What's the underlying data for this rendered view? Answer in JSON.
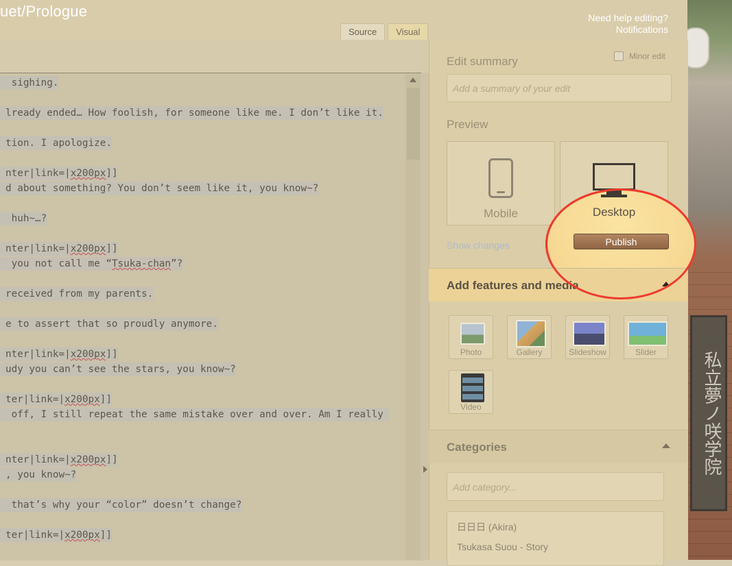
{
  "header": {
    "page_title": "uet/Prologue",
    "help_link": "Need help editing?",
    "notifications_link": "Notifications",
    "tabs": [
      {
        "label": "Source",
        "active": true
      },
      {
        "label": "Visual",
        "active": false
      }
    ]
  },
  "editor": {
    "lines": [
      {
        "parts": [
          {
            "t": " sighing."
          }
        ]
      },
      {
        "parts": [
          {
            "t": "lready ended… How foolish, for someone like me. I don’t like it."
          }
        ]
      },
      {
        "parts": [
          {
            "t": "tion. I apologize."
          }
        ]
      },
      {
        "parts": [
          {
            "t": "nter|link=|"
          },
          {
            "t": "x200px",
            "spell": true
          },
          {
            "t": "]]"
          }
        ]
      },
      {
        "parts": [
          {
            "t": "d about something? You don’t seem like it, you know~?"
          }
        ]
      },
      {
        "parts": [
          {
            "t": " huh~…?"
          }
        ]
      },
      {
        "parts": [
          {
            "t": "nter|link=|"
          },
          {
            "t": "x200px",
            "spell": true
          },
          {
            "t": "]]"
          }
        ]
      },
      {
        "parts": [
          {
            "t": " you not call me “"
          },
          {
            "t": "Tsuka-chan",
            "spell": true
          },
          {
            "t": "”?"
          }
        ]
      },
      {
        "parts": [
          {
            "t": "received from my parents."
          }
        ]
      },
      {
        "parts": [
          {
            "t": "e to assert that so proudly anymore."
          }
        ]
      },
      {
        "parts": [
          {
            "t": "nter|link=|"
          },
          {
            "t": "x200px",
            "spell": true
          },
          {
            "t": "]]"
          }
        ]
      },
      {
        "parts": [
          {
            "t": "udy you can’t see the stars, you know~?"
          }
        ]
      },
      {
        "parts": [
          {
            "t": "ter|link=|"
          },
          {
            "t": "x200px",
            "spell": true
          },
          {
            "t": "]]"
          }
        ]
      },
      {
        "parts": [
          {
            "t": " off, I still repeat the same mistake over and over. Am I really "
          }
        ]
      },
      {
        "parts": [
          {
            "t": "nter|link=|"
          },
          {
            "t": "x200px",
            "spell": true
          },
          {
            "t": "]]"
          }
        ]
      },
      {
        "parts": [
          {
            "t": ", you know~?"
          }
        ]
      },
      {
        "parts": [
          {
            "t": " that’s why your “color” doesn’t change?"
          }
        ]
      },
      {
        "parts": [
          {
            "t": "ter|link=|"
          },
          {
            "t": "x200px",
            "spell": true
          },
          {
            "t": "]]"
          }
        ]
      }
    ]
  },
  "rail": {
    "minor_edit_label": "Minor edit",
    "edit_summary_label": "Edit summary",
    "summary_placeholder": "Add a summary of your edit",
    "preview_label": "Preview",
    "mobile_label": "Mobile",
    "desktop_label": "Desktop",
    "show_changes_label": "Show changes",
    "publish_label": "Publish",
    "features_title": "Add features and media",
    "features": [
      {
        "label": "Photo",
        "icon": "photo-icon"
      },
      {
        "label": "Gallery",
        "icon": "gallery-icon"
      },
      {
        "label": "Slideshow",
        "icon": "slideshow-icon"
      },
      {
        "label": "Slider",
        "icon": "slider-icon"
      },
      {
        "label": "Video",
        "icon": "video-icon"
      }
    ],
    "categories_title": "Categories",
    "category_placeholder": "Add category...",
    "categories": [
      "日日日 (Akira)",
      "Tsukasa Suou - Story"
    ]
  },
  "colors": {
    "publish_button": "#9c714f",
    "highlight_circle": "#ef3b2d",
    "spellcheck_underline": "#c9514a"
  }
}
